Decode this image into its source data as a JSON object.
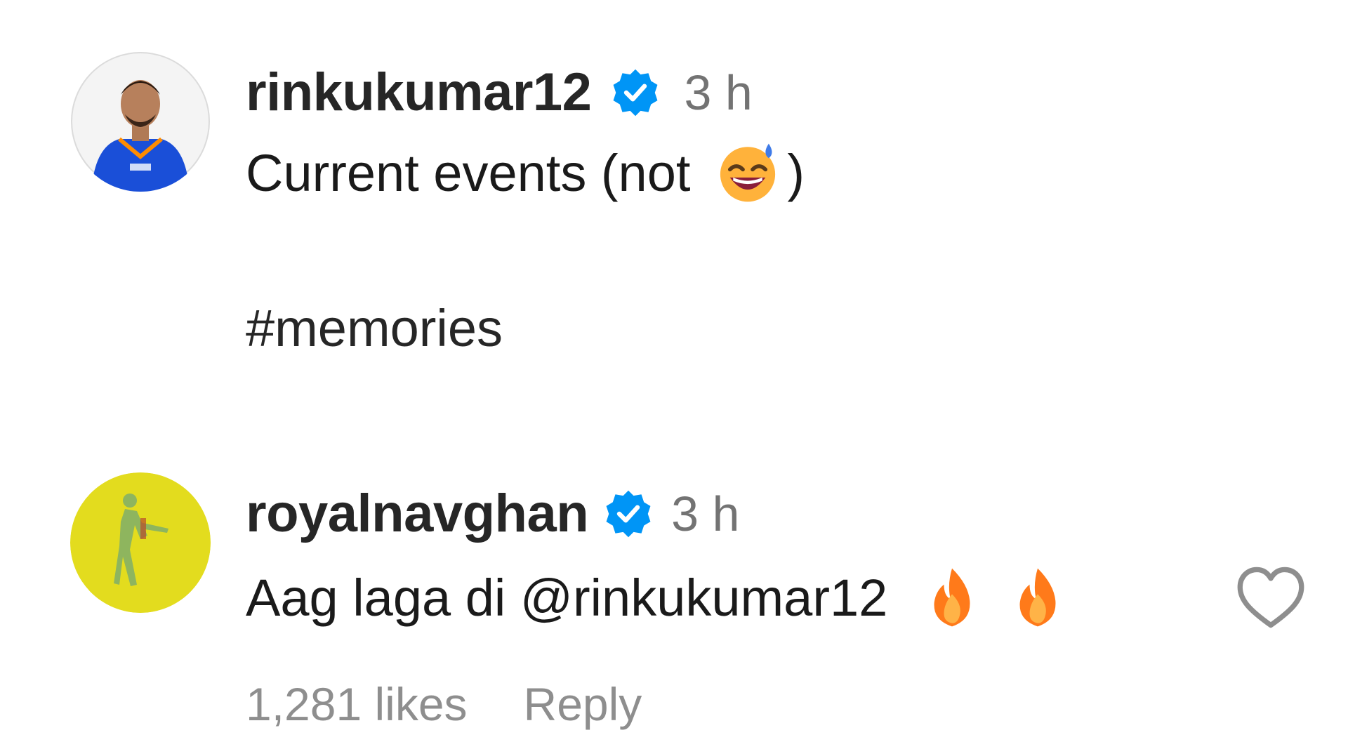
{
  "comments": [
    {
      "username": "rinkukumar12",
      "verified": true,
      "time": "3 h",
      "text_prefix": "Current events (not",
      "emoji": "grinning-sweat-emoji",
      "text_suffix": ")",
      "hashtag": "#memories"
    },
    {
      "username": "royalnavghan",
      "verified": true,
      "time": "3 h",
      "text": "Aag laga di @rinkukumar12",
      "emojis": [
        "fire-emoji",
        "fire-emoji"
      ],
      "likes": "1,281 likes",
      "reply_label": "Reply"
    }
  ],
  "colors": {
    "verified_blue": "#0095f6",
    "muted_gray": "#8e8e8e",
    "text_dark": "#1a1a1a",
    "fire_orange": "#ff7a1a"
  }
}
